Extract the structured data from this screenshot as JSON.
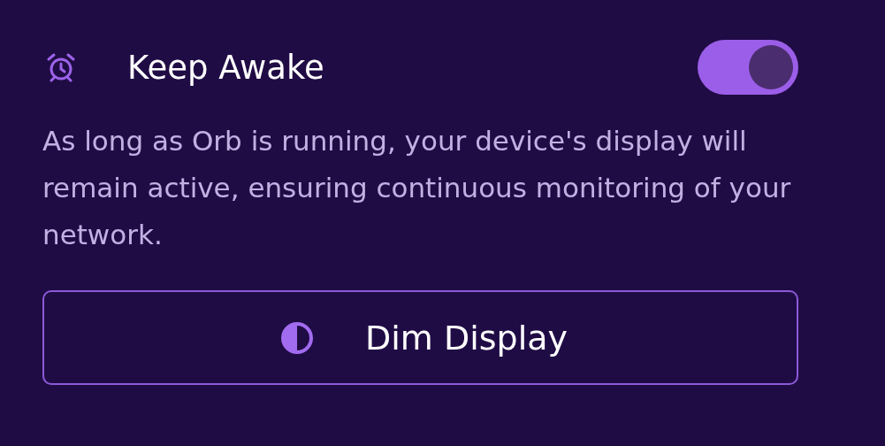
{
  "setting": {
    "title": "Keep Awake",
    "on": true,
    "description": "As long as Orb is running, your device's display will remain active, ensuring continuous monitoring of your network."
  },
  "button": {
    "label": "Dim Display"
  }
}
